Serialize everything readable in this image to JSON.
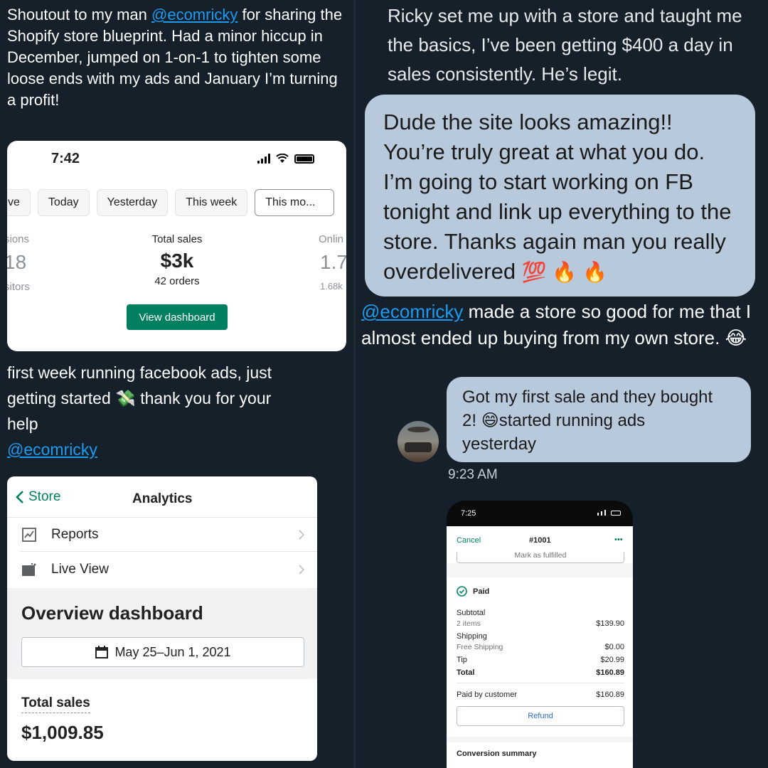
{
  "panel1": {
    "tweet_before": "Shoutout to my man ",
    "mention": "@ecomricky",
    "tweet_after": " for sharing the Shopify store blueprint. Had a minor hiccup in December, jumped on 1-on-1 to tighten some loose ends with my ads and January I’m turning a profit!",
    "phone_time": "7:42",
    "tabs": [
      "ve",
      "Today",
      "Yesterday",
      "This week",
      "This mo..."
    ],
    "left_metric": {
      "label": "sions",
      "value": "18",
      "sub": "sitors"
    },
    "center_metric": {
      "label": "Total sales",
      "value": "$3k",
      "sub": "42 orders"
    },
    "right_metric": {
      "label": "Onlin",
      "value": "1.7",
      "sub": "1.68k"
    },
    "button": "View dashboard"
  },
  "panel2": {
    "tweet": "Ricky set me up with a store and taught me the basics, I’ve been getting $400 a day in sales consistently. He’s legit.",
    "bubble": "Dude the site looks amazing!! You’re truly great at what you do. I’m going to start working on FB tonight and link up everything to the store. Thanks again man you really overdelivered",
    "bubble_emoji": "💯 🔥 🔥"
  },
  "panel3": {
    "tweet_line1": "first week running facebook ads, just",
    "tweet_line2_a": "getting started",
    "tweet_emoji": "💸",
    "tweet_line2_b": "thank you for your",
    "tweet_line3": "help",
    "mention": "@ecomricky",
    "back_label": "Store",
    "nav_title": "Analytics",
    "rows": [
      "Reports",
      "Live View"
    ],
    "overview_title": "Overview dashboard",
    "date_range": "May 25–Jun 1, 2021",
    "total_sales_label": "Total sales",
    "total_sales_value": "$1,009.85"
  },
  "panel4": {
    "mention": "@ecomricky",
    "text": " made a store so good for me that I almost ended up buying from my own store.",
    "emoji": "😂",
    "chat_line1": "Got my first sale and they bought",
    "chat_line2_a": "2!",
    "chat_emoji": "😄",
    "chat_line2_b": "started running ads",
    "chat_line3": "yesterday",
    "timestamp": "9:23 AM",
    "order": {
      "time": "7:25",
      "cancel": "Cancel",
      "title": "#1001",
      "more": "•••",
      "mark_fulfilled": "Mark as fulfilled",
      "status": "Paid",
      "subtotal_label": "Subtotal",
      "items": "2 items",
      "subtotal": "$139.90",
      "shipping_label": "Shipping",
      "shipping_method": "Free Shipping",
      "shipping": "$0.00",
      "tip_label": "Tip",
      "tip": "$20.99",
      "total_label": "Total",
      "total": "$160.89",
      "paid_label": "Paid by customer",
      "paid": "$160.89",
      "refund": "Refund",
      "conversion": "Conversion summary"
    }
  }
}
